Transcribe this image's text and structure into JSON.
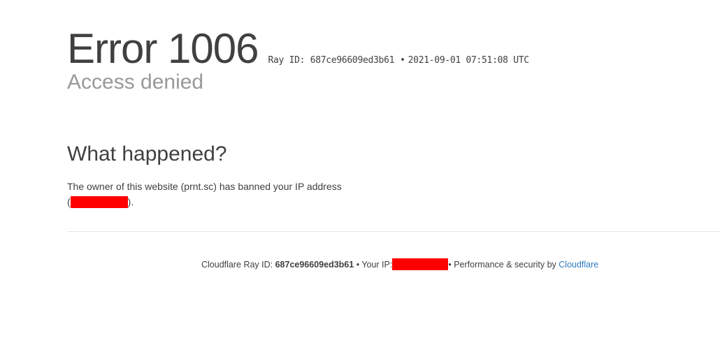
{
  "header": {
    "error_code": "Error 1006",
    "ray_id_text": "Ray ID: 687ce96609ed3b61",
    "bullet": "•",
    "timestamp": "2021-09-01 07:51:08 UTC",
    "subtitle": "Access denied"
  },
  "main": {
    "heading": "What happened?",
    "message_before": "The owner of this website (prnt.sc) has banned your IP address",
    "message_open": "(",
    "message_close": ")."
  },
  "footer": {
    "ray_label": "Cloudflare Ray ID: ",
    "ray_id": "687ce96609ed3b61",
    "separator1": " • ",
    "ip_label": "Your IP:",
    "separator2": "• ",
    "perf_label": "Performance & security by ",
    "cloudflare_link": "Cloudflare"
  },
  "colors": {
    "redaction": "#ff0000",
    "link": "#2f7bbf",
    "subtitle": "#999999",
    "text": "#404040"
  }
}
